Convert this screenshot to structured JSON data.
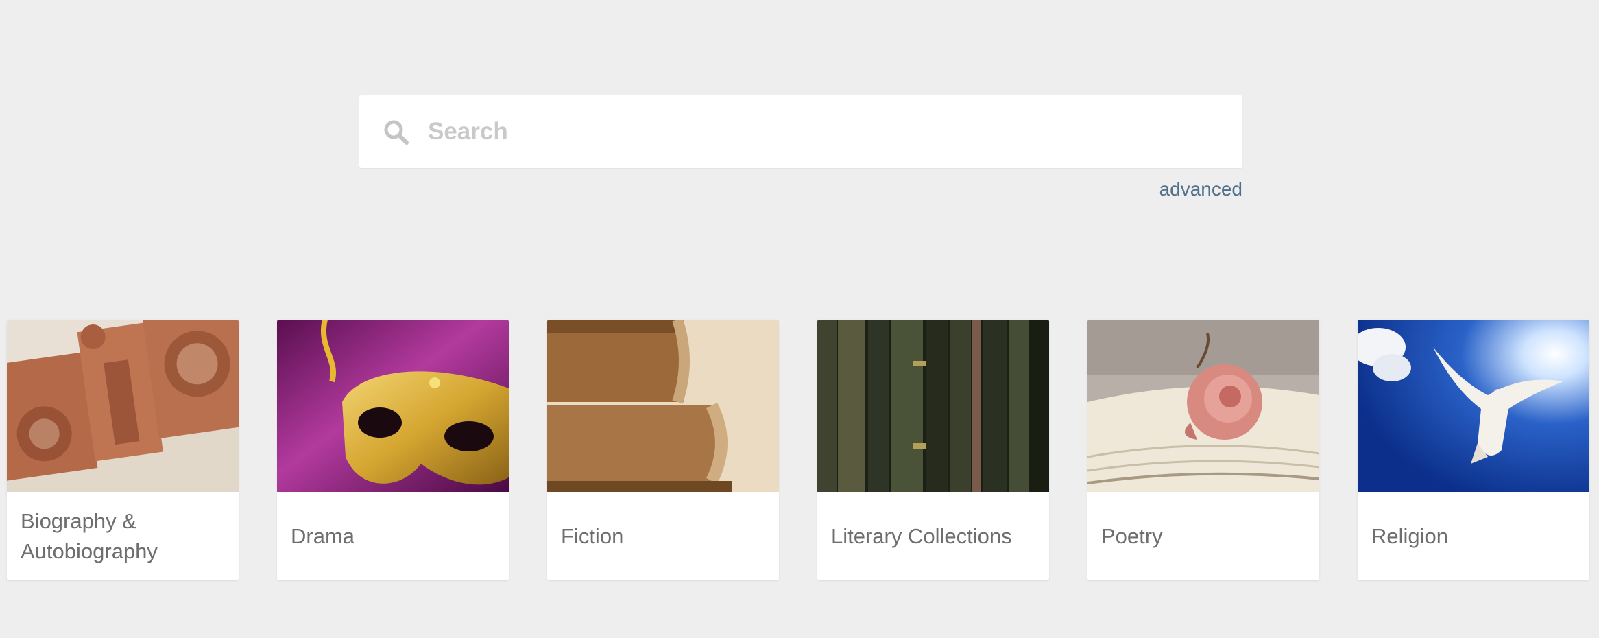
{
  "search": {
    "placeholder": "Search",
    "advanced_label": "advanced"
  },
  "categories": [
    {
      "label": "Biography & Autobiography",
      "image": "letterpress-blocks"
    },
    {
      "label": "Drama",
      "image": "gold-theater-mask"
    },
    {
      "label": "Fiction",
      "image": "stacked-old-books"
    },
    {
      "label": "Literary Collections",
      "image": "book-spines"
    },
    {
      "label": "Poetry",
      "image": "rose-on-open-book"
    },
    {
      "label": "Religion",
      "image": "dove-in-sky"
    }
  ],
  "colors": {
    "background": "#eeeeee",
    "link": "#4f6f8a",
    "card_text": "#6e6e6e",
    "placeholder": "#c9c9c9"
  }
}
